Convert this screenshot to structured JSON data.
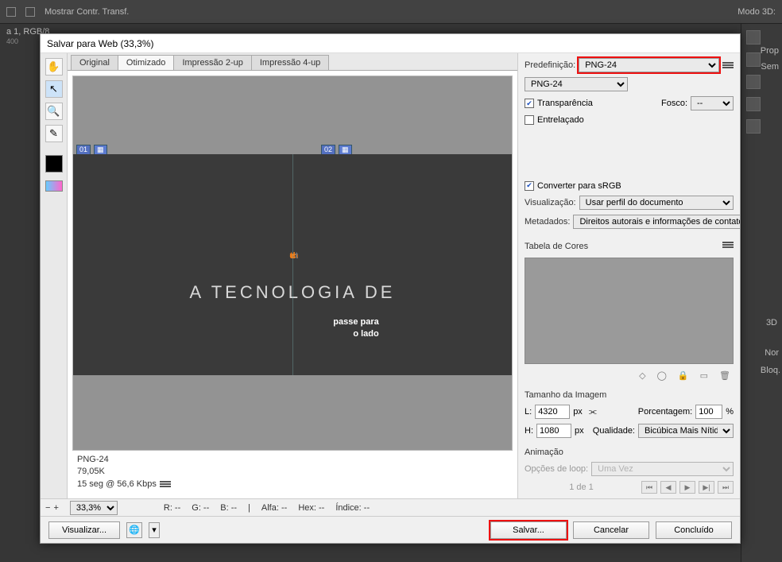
{
  "app": {
    "toolbar_checkbox_label": "Mostrar Contr. Transf.",
    "mode3d_label": "Modo 3D:",
    "doc_info": "a 1, RGB/8",
    "ruler_val": "400",
    "side_panel_1": "Prop",
    "side_panel_2": "Sem",
    "side_panel_3d": "3D",
    "side_panel_nor": "Nor",
    "side_panel_bloq": "Bloq."
  },
  "dialog": {
    "title": "Salvar para Web (33,3%)",
    "tabs": {
      "original": "Original",
      "otimizado": "Otimizado",
      "two_up": "Impressão 2-up",
      "four_up": "Impressão 4-up"
    },
    "slice1": "01",
    "slice2": "02",
    "logo_main": "tech",
    "logo_tail": "t",
    "subtitle": "A TECNOLOGIA DE",
    "passe1": "passe para",
    "passe2": "o lado",
    "info_fmt": "PNG-24",
    "info_size": "79,05K",
    "info_time": "15 seg @ 56,6 Kbps",
    "status": {
      "zoom": "33,3%",
      "r": "R: --",
      "g": "G: --",
      "b": "B: --",
      "alfa": "Alfa: --",
      "hex": "Hex: --",
      "indice": "Índice: --"
    },
    "buttons": {
      "visualizar": "Visualizar...",
      "salvar": "Salvar...",
      "cancelar": "Cancelar",
      "concluido": "Concluído"
    }
  },
  "settings": {
    "predef_label": "Predefinição:",
    "predef_value": "PNG-24",
    "format_value": "PNG-24",
    "transparencia": "Transparência",
    "entrelacado": "Entrelaçado",
    "fosco_label": "Fosco:",
    "fosco_value": "--",
    "srgb": "Converter para sRGB",
    "visualizacao_label": "Visualização:",
    "visualizacao_value": "Usar perfil do documento",
    "metadados_label": "Metadados:",
    "metadados_value": "Direitos autorais e informações de contato",
    "tabela_label": "Tabela de Cores",
    "tamanho_label": "Tamanho da Imagem",
    "L_label": "L:",
    "L_val": "4320",
    "px": "px",
    "H_label": "H:",
    "H_val": "1080",
    "porcent_label": "Porcentagem:",
    "porcent_val": "100",
    "pct": "%",
    "qualidade_label": "Qualidade:",
    "qualidade_val": "Bicúbica Mais Nítida",
    "anim_label": "Animação",
    "loop_label": "Opções de loop:",
    "loop_val": "Uma Vez",
    "frame_of": "1 de 1"
  }
}
